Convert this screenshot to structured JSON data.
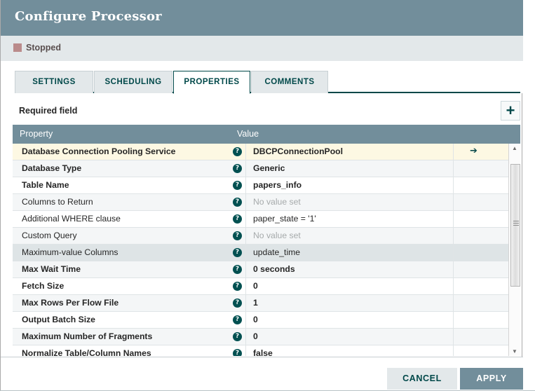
{
  "dialog": {
    "title": "Configure Processor",
    "status": {
      "label": "Stopped",
      "color": "#ba8b8b"
    }
  },
  "tabs": [
    {
      "label": "SETTINGS",
      "active": false
    },
    {
      "label": "SCHEDULING",
      "active": false
    },
    {
      "label": "PROPERTIES",
      "active": true
    },
    {
      "label": "COMMENTS",
      "active": false
    }
  ],
  "toolbar": {
    "required_field_label": "Required field",
    "add_property_icon": "plus-icon",
    "add_property_glyph": "+"
  },
  "table": {
    "columns": [
      "Property",
      "Value"
    ],
    "help_icon_glyph": "?",
    "goto_icon_glyph": "➔",
    "unset_text": "No value set",
    "rows": [
      {
        "name": "Database Connection Pooling Service",
        "value": "DBCPConnectionPool",
        "required": true,
        "unset": false,
        "state": "highlight",
        "goto": true
      },
      {
        "name": "Database Type",
        "value": "Generic",
        "required": true,
        "unset": false,
        "state": "odd",
        "goto": false
      },
      {
        "name": "Table Name",
        "value": "papers_info",
        "required": true,
        "unset": false,
        "state": "even",
        "goto": false
      },
      {
        "name": "Columns to Return",
        "value": "No value set",
        "required": false,
        "unset": true,
        "state": "odd",
        "goto": false
      },
      {
        "name": "Additional WHERE clause",
        "value": "paper_state = '1'",
        "required": false,
        "unset": false,
        "state": "even",
        "goto": false
      },
      {
        "name": "Custom Query",
        "value": "No value set",
        "required": false,
        "unset": true,
        "state": "odd",
        "goto": false
      },
      {
        "name": "Maximum-value Columns",
        "value": "update_time",
        "required": false,
        "unset": false,
        "state": "selected",
        "goto": false
      },
      {
        "name": "Max Wait Time",
        "value": "0 seconds",
        "required": true,
        "unset": false,
        "state": "odd",
        "goto": false
      },
      {
        "name": "Fetch Size",
        "value": "0",
        "required": true,
        "unset": false,
        "state": "even",
        "goto": false
      },
      {
        "name": "Max Rows Per Flow File",
        "value": "1",
        "required": true,
        "unset": false,
        "state": "odd",
        "goto": false
      },
      {
        "name": "Output Batch Size",
        "value": "0",
        "required": true,
        "unset": false,
        "state": "even",
        "goto": false
      },
      {
        "name": "Maximum Number of Fragments",
        "value": "0",
        "required": true,
        "unset": false,
        "state": "odd",
        "goto": false
      },
      {
        "name": "Normalize Table/Column Names",
        "value": "false",
        "required": true,
        "unset": false,
        "state": "even",
        "goto": false
      }
    ]
  },
  "scrollbar": {
    "up_arrow_glyph": "▲",
    "down_arrow_glyph": "▼"
  },
  "footer": {
    "cancel_label": "CANCEL",
    "apply_label": "APPLY"
  },
  "colors": {
    "header_bg": "#728e9b",
    "accent": "#004849",
    "status_red": "#ba8b8b",
    "row_highlight": "#fdf8e3",
    "row_selected": "#dee4e6"
  }
}
